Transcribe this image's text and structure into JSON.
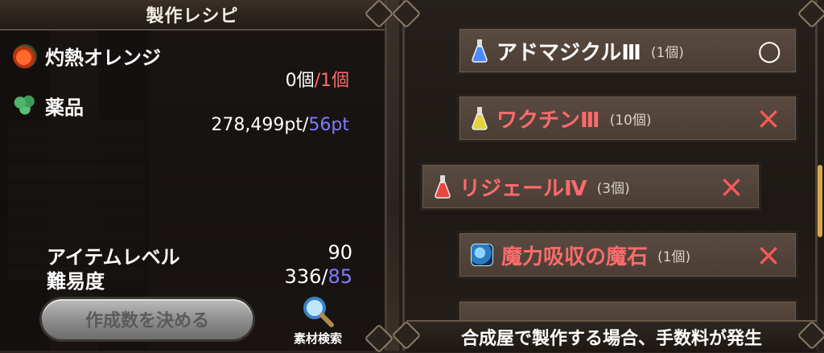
{
  "left_panel": {
    "title": "製作レシピ",
    "materials": [
      {
        "name": "灼熱オレンジ",
        "icon": "orange-fruit-icon",
        "have": "0個",
        "slash": "/",
        "need": "1個"
      },
      {
        "name": "薬品",
        "icon": "herb-icon",
        "have": "278,499pt",
        "slash": "/",
        "need": "56pt"
      }
    ],
    "stats": [
      {
        "label": "アイテムレベル",
        "value": "90"
      },
      {
        "label": "難易度",
        "value": "336",
        "slash": "/",
        "value2": "85"
      }
    ],
    "decide_button_label": "作成数を決める",
    "search_label": "素材検索"
  },
  "recipes": [
    {
      "name": "アドマジクルⅢ",
      "qty": "(1個)",
      "status": "○",
      "craftable": true,
      "icon": "flask-blue-icon"
    },
    {
      "name": "ワクチンⅢ",
      "qty": "(10個)",
      "status": "×",
      "craftable": false,
      "icon": "flask-yellow-icon"
    },
    {
      "name": "リジェールⅣ",
      "qty": "(3個)",
      "status": "×",
      "craftable": false,
      "icon": "flask-red-icon"
    },
    {
      "name": "魔力吸収の魔石",
      "qty": "(1個)",
      "status": "×",
      "craftable": false,
      "icon": "magic-stone-icon"
    }
  ],
  "notice": "合成屋で製作する場合、手数料が発生",
  "colors": {
    "need_red": "#ff6b6b",
    "need_blue": "#7f7bff",
    "cross": "#ff5a5a"
  }
}
